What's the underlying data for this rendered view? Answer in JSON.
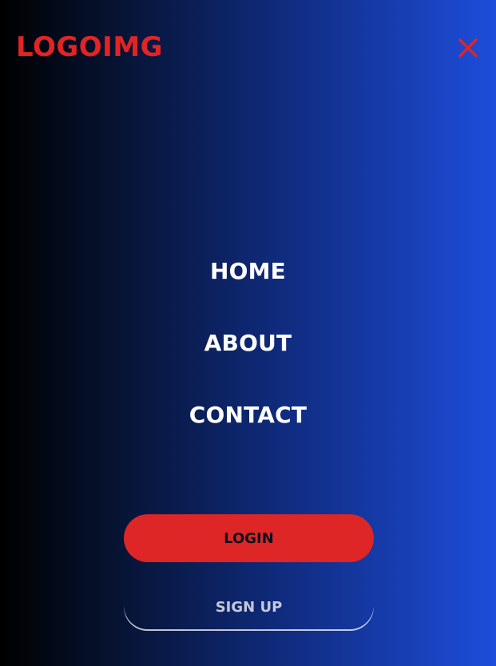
{
  "header": {
    "logo_text": "LOGOIMG",
    "close_icon": "close-x-icon"
  },
  "nav": {
    "items": [
      {
        "label": "HOME"
      },
      {
        "label": "ABOUT"
      },
      {
        "label": "CONTACT"
      }
    ]
  },
  "actions": {
    "login_label": "LOGIN",
    "signup_label": "SIGN UP"
  },
  "colors": {
    "accent_red": "#E12424",
    "background_left": "#000000",
    "background_right": "#1D4DDB",
    "text_primary": "#FFFFFF"
  }
}
